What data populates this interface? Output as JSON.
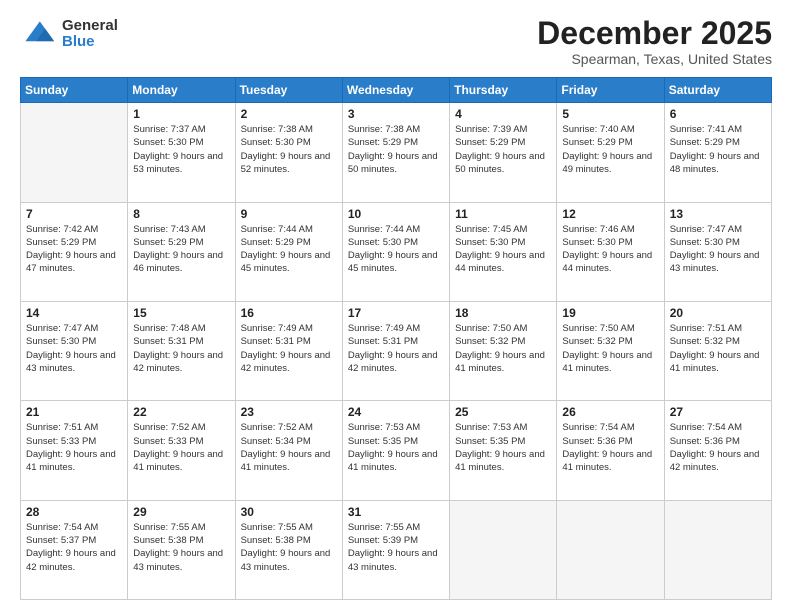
{
  "header": {
    "logo_general": "General",
    "logo_blue": "Blue",
    "month_title": "December 2025",
    "location": "Spearman, Texas, United States"
  },
  "days_of_week": [
    "Sunday",
    "Monday",
    "Tuesday",
    "Wednesday",
    "Thursday",
    "Friday",
    "Saturday"
  ],
  "weeks": [
    [
      {
        "day": "",
        "empty": true
      },
      {
        "day": "1",
        "sunrise": "Sunrise: 7:37 AM",
        "sunset": "Sunset: 5:30 PM",
        "daylight": "Daylight: 9 hours and 53 minutes."
      },
      {
        "day": "2",
        "sunrise": "Sunrise: 7:38 AM",
        "sunset": "Sunset: 5:30 PM",
        "daylight": "Daylight: 9 hours and 52 minutes."
      },
      {
        "day": "3",
        "sunrise": "Sunrise: 7:38 AM",
        "sunset": "Sunset: 5:29 PM",
        "daylight": "Daylight: 9 hours and 50 minutes."
      },
      {
        "day": "4",
        "sunrise": "Sunrise: 7:39 AM",
        "sunset": "Sunset: 5:29 PM",
        "daylight": "Daylight: 9 hours and 50 minutes."
      },
      {
        "day": "5",
        "sunrise": "Sunrise: 7:40 AM",
        "sunset": "Sunset: 5:29 PM",
        "daylight": "Daylight: 9 hours and 49 minutes."
      },
      {
        "day": "6",
        "sunrise": "Sunrise: 7:41 AM",
        "sunset": "Sunset: 5:29 PM",
        "daylight": "Daylight: 9 hours and 48 minutes."
      }
    ],
    [
      {
        "day": "7",
        "sunrise": "Sunrise: 7:42 AM",
        "sunset": "Sunset: 5:29 PM",
        "daylight": "Daylight: 9 hours and 47 minutes."
      },
      {
        "day": "8",
        "sunrise": "Sunrise: 7:43 AM",
        "sunset": "Sunset: 5:29 PM",
        "daylight": "Daylight: 9 hours and 46 minutes."
      },
      {
        "day": "9",
        "sunrise": "Sunrise: 7:44 AM",
        "sunset": "Sunset: 5:29 PM",
        "daylight": "Daylight: 9 hours and 45 minutes."
      },
      {
        "day": "10",
        "sunrise": "Sunrise: 7:44 AM",
        "sunset": "Sunset: 5:30 PM",
        "daylight": "Daylight: 9 hours and 45 minutes."
      },
      {
        "day": "11",
        "sunrise": "Sunrise: 7:45 AM",
        "sunset": "Sunset: 5:30 PM",
        "daylight": "Daylight: 9 hours and 44 minutes."
      },
      {
        "day": "12",
        "sunrise": "Sunrise: 7:46 AM",
        "sunset": "Sunset: 5:30 PM",
        "daylight": "Daylight: 9 hours and 44 minutes."
      },
      {
        "day": "13",
        "sunrise": "Sunrise: 7:47 AM",
        "sunset": "Sunset: 5:30 PM",
        "daylight": "Daylight: 9 hours and 43 minutes."
      }
    ],
    [
      {
        "day": "14",
        "sunrise": "Sunrise: 7:47 AM",
        "sunset": "Sunset: 5:30 PM",
        "daylight": "Daylight: 9 hours and 43 minutes."
      },
      {
        "day": "15",
        "sunrise": "Sunrise: 7:48 AM",
        "sunset": "Sunset: 5:31 PM",
        "daylight": "Daylight: 9 hours and 42 minutes."
      },
      {
        "day": "16",
        "sunrise": "Sunrise: 7:49 AM",
        "sunset": "Sunset: 5:31 PM",
        "daylight": "Daylight: 9 hours and 42 minutes."
      },
      {
        "day": "17",
        "sunrise": "Sunrise: 7:49 AM",
        "sunset": "Sunset: 5:31 PM",
        "daylight": "Daylight: 9 hours and 42 minutes."
      },
      {
        "day": "18",
        "sunrise": "Sunrise: 7:50 AM",
        "sunset": "Sunset: 5:32 PM",
        "daylight": "Daylight: 9 hours and 41 minutes."
      },
      {
        "day": "19",
        "sunrise": "Sunrise: 7:50 AM",
        "sunset": "Sunset: 5:32 PM",
        "daylight": "Daylight: 9 hours and 41 minutes."
      },
      {
        "day": "20",
        "sunrise": "Sunrise: 7:51 AM",
        "sunset": "Sunset: 5:32 PM",
        "daylight": "Daylight: 9 hours and 41 minutes."
      }
    ],
    [
      {
        "day": "21",
        "sunrise": "Sunrise: 7:51 AM",
        "sunset": "Sunset: 5:33 PM",
        "daylight": "Daylight: 9 hours and 41 minutes."
      },
      {
        "day": "22",
        "sunrise": "Sunrise: 7:52 AM",
        "sunset": "Sunset: 5:33 PM",
        "daylight": "Daylight: 9 hours and 41 minutes."
      },
      {
        "day": "23",
        "sunrise": "Sunrise: 7:52 AM",
        "sunset": "Sunset: 5:34 PM",
        "daylight": "Daylight: 9 hours and 41 minutes."
      },
      {
        "day": "24",
        "sunrise": "Sunrise: 7:53 AM",
        "sunset": "Sunset: 5:35 PM",
        "daylight": "Daylight: 9 hours and 41 minutes."
      },
      {
        "day": "25",
        "sunrise": "Sunrise: 7:53 AM",
        "sunset": "Sunset: 5:35 PM",
        "daylight": "Daylight: 9 hours and 41 minutes."
      },
      {
        "day": "26",
        "sunrise": "Sunrise: 7:54 AM",
        "sunset": "Sunset: 5:36 PM",
        "daylight": "Daylight: 9 hours and 41 minutes."
      },
      {
        "day": "27",
        "sunrise": "Sunrise: 7:54 AM",
        "sunset": "Sunset: 5:36 PM",
        "daylight": "Daylight: 9 hours and 42 minutes."
      }
    ],
    [
      {
        "day": "28",
        "sunrise": "Sunrise: 7:54 AM",
        "sunset": "Sunset: 5:37 PM",
        "daylight": "Daylight: 9 hours and 42 minutes."
      },
      {
        "day": "29",
        "sunrise": "Sunrise: 7:55 AM",
        "sunset": "Sunset: 5:38 PM",
        "daylight": "Daylight: 9 hours and 43 minutes."
      },
      {
        "day": "30",
        "sunrise": "Sunrise: 7:55 AM",
        "sunset": "Sunset: 5:38 PM",
        "daylight": "Daylight: 9 hours and 43 minutes."
      },
      {
        "day": "31",
        "sunrise": "Sunrise: 7:55 AM",
        "sunset": "Sunset: 5:39 PM",
        "daylight": "Daylight: 9 hours and 43 minutes."
      },
      {
        "day": "",
        "empty": true
      },
      {
        "day": "",
        "empty": true
      },
      {
        "day": "",
        "empty": true
      }
    ]
  ]
}
